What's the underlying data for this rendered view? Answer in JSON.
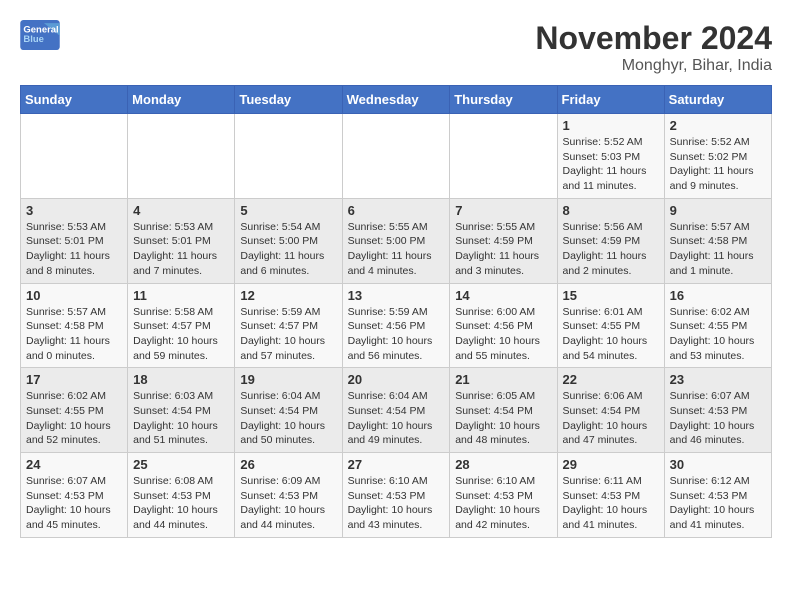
{
  "logo": {
    "line1": "General",
    "line2": "Blue"
  },
  "title": "November 2024",
  "location": "Monghyr, Bihar, India",
  "days_header": [
    "Sunday",
    "Monday",
    "Tuesday",
    "Wednesday",
    "Thursday",
    "Friday",
    "Saturday"
  ],
  "weeks": [
    [
      {
        "day": "",
        "info": ""
      },
      {
        "day": "",
        "info": ""
      },
      {
        "day": "",
        "info": ""
      },
      {
        "day": "",
        "info": ""
      },
      {
        "day": "",
        "info": ""
      },
      {
        "day": "1",
        "info": "Sunrise: 5:52 AM\nSunset: 5:03 PM\nDaylight: 11 hours and 11 minutes."
      },
      {
        "day": "2",
        "info": "Sunrise: 5:52 AM\nSunset: 5:02 PM\nDaylight: 11 hours and 9 minutes."
      }
    ],
    [
      {
        "day": "3",
        "info": "Sunrise: 5:53 AM\nSunset: 5:01 PM\nDaylight: 11 hours and 8 minutes."
      },
      {
        "day": "4",
        "info": "Sunrise: 5:53 AM\nSunset: 5:01 PM\nDaylight: 11 hours and 7 minutes."
      },
      {
        "day": "5",
        "info": "Sunrise: 5:54 AM\nSunset: 5:00 PM\nDaylight: 11 hours and 6 minutes."
      },
      {
        "day": "6",
        "info": "Sunrise: 5:55 AM\nSunset: 5:00 PM\nDaylight: 11 hours and 4 minutes."
      },
      {
        "day": "7",
        "info": "Sunrise: 5:55 AM\nSunset: 4:59 PM\nDaylight: 11 hours and 3 minutes."
      },
      {
        "day": "8",
        "info": "Sunrise: 5:56 AM\nSunset: 4:59 PM\nDaylight: 11 hours and 2 minutes."
      },
      {
        "day": "9",
        "info": "Sunrise: 5:57 AM\nSunset: 4:58 PM\nDaylight: 11 hours and 1 minute."
      }
    ],
    [
      {
        "day": "10",
        "info": "Sunrise: 5:57 AM\nSunset: 4:58 PM\nDaylight: 11 hours and 0 minutes."
      },
      {
        "day": "11",
        "info": "Sunrise: 5:58 AM\nSunset: 4:57 PM\nDaylight: 10 hours and 59 minutes."
      },
      {
        "day": "12",
        "info": "Sunrise: 5:59 AM\nSunset: 4:57 PM\nDaylight: 10 hours and 57 minutes."
      },
      {
        "day": "13",
        "info": "Sunrise: 5:59 AM\nSunset: 4:56 PM\nDaylight: 10 hours and 56 minutes."
      },
      {
        "day": "14",
        "info": "Sunrise: 6:00 AM\nSunset: 4:56 PM\nDaylight: 10 hours and 55 minutes."
      },
      {
        "day": "15",
        "info": "Sunrise: 6:01 AM\nSunset: 4:55 PM\nDaylight: 10 hours and 54 minutes."
      },
      {
        "day": "16",
        "info": "Sunrise: 6:02 AM\nSunset: 4:55 PM\nDaylight: 10 hours and 53 minutes."
      }
    ],
    [
      {
        "day": "17",
        "info": "Sunrise: 6:02 AM\nSunset: 4:55 PM\nDaylight: 10 hours and 52 minutes."
      },
      {
        "day": "18",
        "info": "Sunrise: 6:03 AM\nSunset: 4:54 PM\nDaylight: 10 hours and 51 minutes."
      },
      {
        "day": "19",
        "info": "Sunrise: 6:04 AM\nSunset: 4:54 PM\nDaylight: 10 hours and 50 minutes."
      },
      {
        "day": "20",
        "info": "Sunrise: 6:04 AM\nSunset: 4:54 PM\nDaylight: 10 hours and 49 minutes."
      },
      {
        "day": "21",
        "info": "Sunrise: 6:05 AM\nSunset: 4:54 PM\nDaylight: 10 hours and 48 minutes."
      },
      {
        "day": "22",
        "info": "Sunrise: 6:06 AM\nSunset: 4:54 PM\nDaylight: 10 hours and 47 minutes."
      },
      {
        "day": "23",
        "info": "Sunrise: 6:07 AM\nSunset: 4:53 PM\nDaylight: 10 hours and 46 minutes."
      }
    ],
    [
      {
        "day": "24",
        "info": "Sunrise: 6:07 AM\nSunset: 4:53 PM\nDaylight: 10 hours and 45 minutes."
      },
      {
        "day": "25",
        "info": "Sunrise: 6:08 AM\nSunset: 4:53 PM\nDaylight: 10 hours and 44 minutes."
      },
      {
        "day": "26",
        "info": "Sunrise: 6:09 AM\nSunset: 4:53 PM\nDaylight: 10 hours and 44 minutes."
      },
      {
        "day": "27",
        "info": "Sunrise: 6:10 AM\nSunset: 4:53 PM\nDaylight: 10 hours and 43 minutes."
      },
      {
        "day": "28",
        "info": "Sunrise: 6:10 AM\nSunset: 4:53 PM\nDaylight: 10 hours and 42 minutes."
      },
      {
        "day": "29",
        "info": "Sunrise: 6:11 AM\nSunset: 4:53 PM\nDaylight: 10 hours and 41 minutes."
      },
      {
        "day": "30",
        "info": "Sunrise: 6:12 AM\nSunset: 4:53 PM\nDaylight: 10 hours and 41 minutes."
      }
    ]
  ]
}
